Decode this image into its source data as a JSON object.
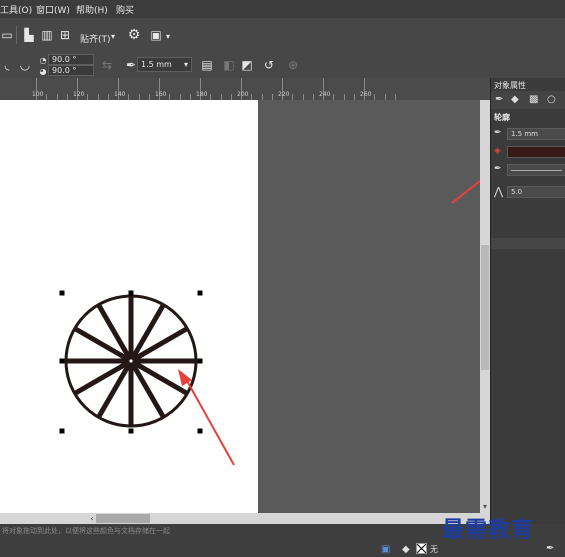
{
  "menu": {
    "tools": "工具(O)",
    "window": "窗口(W)",
    "help": "帮助(H)",
    "buy": "购买"
  },
  "toolbar": {
    "snap_label": "贴齐(T)",
    "angle1": "90.0 °",
    "angle2": "90.0 °",
    "outline_width": "1.5 mm"
  },
  "ruler": {
    "ticks": [
      "100",
      "120",
      "140",
      "160",
      "180",
      "200",
      "220",
      "240",
      "260"
    ]
  },
  "panel": {
    "title": "对象属性",
    "section": "轮廓",
    "width_value": "1.5 mm",
    "miter_value": "5.0"
  },
  "status": {
    "hint": "将对象拖动到此处，以便将这些颜色与文档存储在一起",
    "fill_none": "无"
  },
  "watermark": "最需教育",
  "colors": {
    "arrow": "#e8403a",
    "outline_swatch": "#3a1a16",
    "shape_stroke": "#231815"
  }
}
